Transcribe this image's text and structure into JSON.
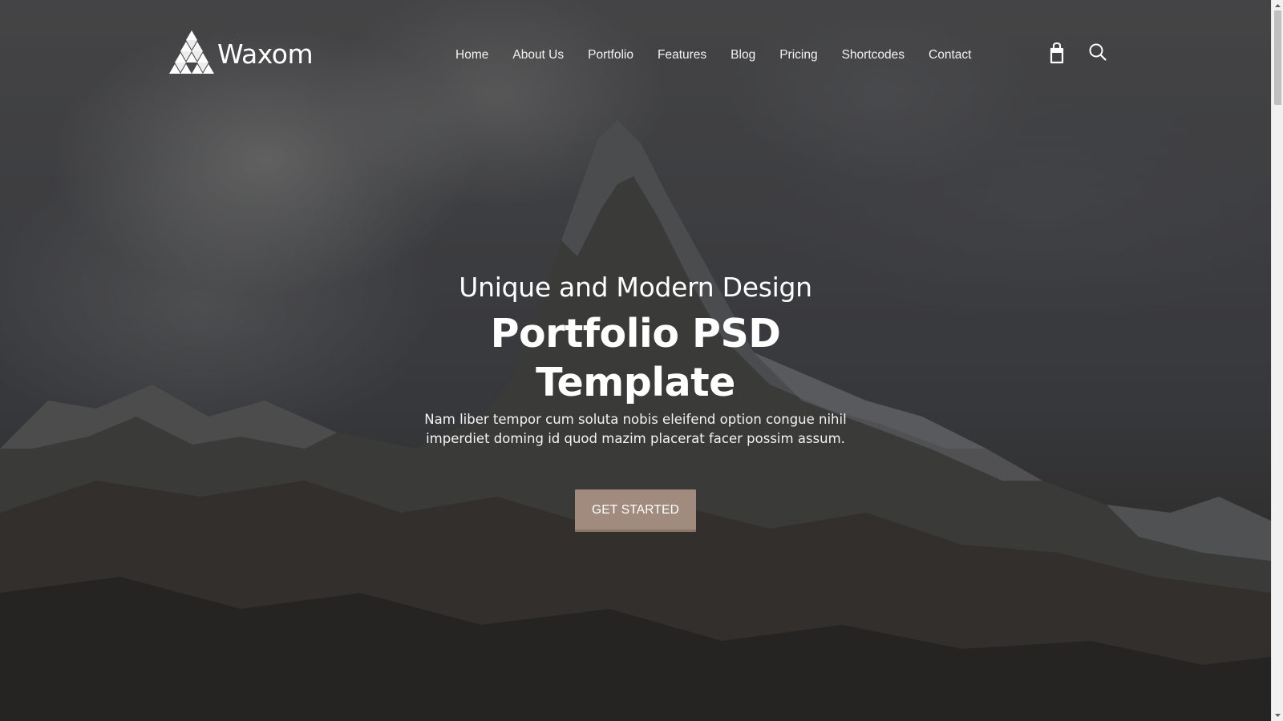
{
  "brand": {
    "name": "Waxom",
    "logo_icon": "triangle-logo-icon"
  },
  "nav": {
    "items": [
      {
        "label": "Home"
      },
      {
        "label": "About Us"
      },
      {
        "label": "Portfolio"
      },
      {
        "label": "Features"
      },
      {
        "label": "Blog"
      },
      {
        "label": "Pricing"
      },
      {
        "label": "Shortcodes"
      },
      {
        "label": "Contact"
      }
    ]
  },
  "header_icons": {
    "cart": "shopping-bag-icon",
    "search": "search-icon"
  },
  "hero": {
    "subtitle": "Unique and Modern Design",
    "title": "Portfolio PSD Template",
    "text": "Nam liber tempor cum soluta nobis eleifend option congue nihil imperdiet doming id quod mazim placerat facer possim assum.",
    "cta_label": "GET STARTED"
  },
  "colors": {
    "accent": "#a18b7f",
    "text": "#ffffff",
    "overlay": "#1c1c20"
  }
}
